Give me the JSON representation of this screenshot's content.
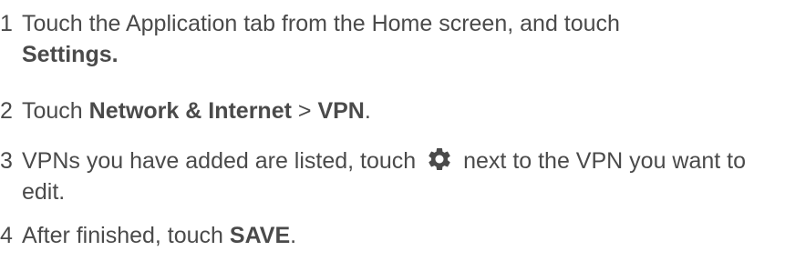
{
  "colors": {
    "text": "#4a4a4a",
    "icon": "#4a4a4a"
  },
  "steps": [
    {
      "number": "1",
      "text_a": "Touch the Application tab from the Home screen, and touch",
      "bold_a": "Settings."
    },
    {
      "number": "2",
      "text_a": "Touch ",
      "bold_a": "Network & Internet",
      "text_b": " > ",
      "bold_b": "VPN",
      "text_c": "."
    },
    {
      "number": "3",
      "text_a": "VPNs you have added are listed, touch ",
      "icon": "gear-icon",
      "text_b": " next to the VPN you want to edit."
    },
    {
      "number": "4",
      "text_a": "After finished, touch ",
      "bold_a": "SAVE",
      "text_b": "."
    }
  ]
}
